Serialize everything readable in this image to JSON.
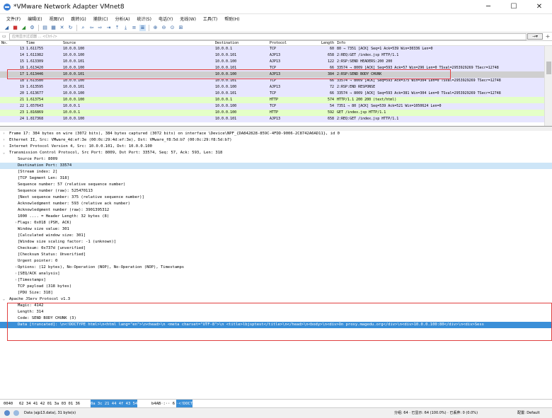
{
  "window": {
    "title": "*VMware Network Adapter VMnet8",
    "minimize": "─",
    "maximize": "☐",
    "close": "✕"
  },
  "menu": [
    "文件(F)",
    "编辑(E)",
    "视图(V)",
    "跳转(G)",
    "捕获(C)",
    "分析(A)",
    "统计(S)",
    "电话(Y)",
    "无线(W)",
    "工具(T)",
    "帮助(H)"
  ],
  "filter": {
    "placeholder": "应用显示过滤器 … <Ctrl-/>",
    "arrow": "→▾",
    "plus": "+"
  },
  "columns": {
    "no": "No.",
    "time": "Time",
    "source": "Source",
    "destination": "Destination",
    "protocol": "Protocol",
    "length": "Length",
    "info": "Info"
  },
  "packets": [
    {
      "no": "13",
      "time": "1.611755",
      "src": "10.0.0.100",
      "dst": "10.0.0.1",
      "proto": "TCP",
      "len": "60",
      "info": "80 → 7351 [ACK] Seq=1 Ack=539 Win=30336 Len=0",
      "bg": "#e7e6ff"
    },
    {
      "no": "14",
      "time": "1.611982",
      "src": "10.0.0.100",
      "dst": "10.0.0.101",
      "proto": "AJP13",
      "len": "658",
      "info": "2:REQ:GET /index.jsp HTTP/1.1",
      "bg": "#e7e6ff"
    },
    {
      "no": "15",
      "time": "1.613309",
      "src": "10.0.0.101",
      "dst": "10.0.0.100",
      "proto": "AJP13",
      "len": "122",
      "info": "2:RSP:SEND HEADERS:200 200",
      "bg": "#e7e6ff"
    },
    {
      "no": "16",
      "time": "1.613420",
      "src": "10.0.0.100",
      "dst": "10.0.0.101",
      "proto": "TCP",
      "len": "66",
      "info": "33574 → 8009 [ACK] Seq=593 Ack=57 Win=296 Len=0 TSval=2953929269 TSecr=12748",
      "bg": "#e7e6ff"
    },
    {
      "no": "17",
      "time": "1.613446",
      "src": "10.0.0.101",
      "dst": "10.0.0.100",
      "proto": "AJP13",
      "len": "384",
      "info": "2:RSP:SEND BODY CHUNK",
      "bg": "#cfcfcf"
    },
    {
      "no": "18",
      "time": "1.613580",
      "src": "10.0.0.100",
      "dst": "10.0.0.101",
      "proto": "TCP",
      "len": "66",
      "info": "33574 → 8009 [ACK] Seq=593 Ack=375 Win=304 Len=0 TSval=2953929269 TSecr=12748",
      "bg": "#e7e6ff"
    },
    {
      "no": "19",
      "time": "1.613595",
      "src": "10.0.0.101",
      "dst": "10.0.0.100",
      "proto": "AJP13",
      "len": "72",
      "info": "2:RSP:END RESPONSE",
      "bg": "#e7e6ff"
    },
    {
      "no": "20",
      "time": "1.613677",
      "src": "10.0.0.100",
      "dst": "10.0.0.101",
      "proto": "TCP",
      "len": "66",
      "info": "33574 → 8009 [ACK] Seq=593 Ack=381 Win=304 Len=0 TSval=2953929269 TSecr=12748",
      "bg": "#e7e6ff"
    },
    {
      "no": "21",
      "time": "1.613754",
      "src": "10.0.0.100",
      "dst": "10.0.0.1",
      "proto": "HTTP",
      "len": "574",
      "info": "HTTP/1.1 200 200  (text/html)",
      "bg": "#e4ffc7"
    },
    {
      "no": "22",
      "time": "1.657643",
      "src": "10.0.0.1",
      "dst": "10.0.0.100",
      "proto": "TCP",
      "len": "54",
      "info": "7351 → 80 [ACK] Seq=539 Ack=521 Win=1050624 Len=0",
      "bg": "#e7e6ff"
    },
    {
      "no": "23",
      "time": "1.816869",
      "src": "10.0.0.1",
      "dst": "10.0.0.100",
      "proto": "HTTP",
      "len": "592",
      "info": "GET /index.jsp HTTP/1.1",
      "bg": "#e4ffc7"
    },
    {
      "no": "24",
      "time": "1.817368",
      "src": "10.0.0.100",
      "dst": "10.0.0.101",
      "proto": "AJP13",
      "len": "658",
      "info": "2:REQ:GET /index.jsp HTTP/1.1",
      "bg": "#e7e6ff"
    }
  ],
  "details": [
    {
      "text": "Frame 17: 384 bytes on wire (3072 bits), 384 bytes captured (3072 bits) on interface \\Device\\NPF_{DA842828-859C-4FDD-9006-2C8742A6AD11}, id 0",
      "indent": 0,
      "tri": "›",
      "style": ""
    },
    {
      "text": "Ethernet II, Src: VMware_4d:ef:3e (00:0c:29:4d:ef:3e), Dst: VMware_f8:5d:b7 (00:0c:29:f8:5d:b7)",
      "indent": 0,
      "tri": "›",
      "style": ""
    },
    {
      "text": "Internet Protocol Version 4, Src: 10.0.0.101, Dst: 10.0.0.100",
      "indent": 0,
      "tri": "›",
      "style": ""
    },
    {
      "text": "Transmission Control Protocol, Src Port: 8009, Dst Port: 33574, Seq: 57, Ack: 593, Len: 318",
      "indent": 0,
      "tri": "⌄",
      "style": ""
    },
    {
      "text": "Source Port: 8009",
      "indent": 1,
      "tri": "",
      "style": ""
    },
    {
      "text": "Destination Port: 33574",
      "indent": 1,
      "tri": "",
      "style": "sel"
    },
    {
      "text": "[Stream index: 2]",
      "indent": 1,
      "tri": "",
      "style": ""
    },
    {
      "text": "[TCP Segment Len: 318]",
      "indent": 1,
      "tri": "",
      "style": ""
    },
    {
      "text": "Sequence number: 57    (relative sequence number)",
      "indent": 1,
      "tri": "",
      "style": ""
    },
    {
      "text": "Sequence number (raw): 525470113",
      "indent": 1,
      "tri": "",
      "style": ""
    },
    {
      "text": "[Next sequence number: 375    (relative sequence number)]",
      "indent": 1,
      "tri": "",
      "style": ""
    },
    {
      "text": "Acknowledgment number: 593    (relative ack number)",
      "indent": 1,
      "tri": "",
      "style": ""
    },
    {
      "text": "Acknowledgment number (raw): 3901395312",
      "indent": 1,
      "tri": "",
      "style": ""
    },
    {
      "text": "1000 .... = Header Length: 32 bytes (8)",
      "indent": 1,
      "tri": "",
      "style": ""
    },
    {
      "text": "Flags: 0x018 (PSH, ACK)",
      "indent": 1,
      "tri": "›",
      "style": ""
    },
    {
      "text": "Window size value: 301",
      "indent": 1,
      "tri": "",
      "style": ""
    },
    {
      "text": "[Calculated window size: 301]",
      "indent": 1,
      "tri": "",
      "style": ""
    },
    {
      "text": "[Window size scaling factor: -1 (unknown)]",
      "indent": 1,
      "tri": "",
      "style": ""
    },
    {
      "text": "Checksum: 0x737d [unverified]",
      "indent": 1,
      "tri": "",
      "style": ""
    },
    {
      "text": "[Checksum Status: Unverified]",
      "indent": 1,
      "tri": "",
      "style": ""
    },
    {
      "text": "Urgent pointer: 0",
      "indent": 1,
      "tri": "",
      "style": ""
    },
    {
      "text": "Options: (12 bytes), No-Operation (NOP), No-Operation (NOP), Timestamps",
      "indent": 1,
      "tri": "›",
      "style": ""
    },
    {
      "text": "[SEQ/ACK analysis]",
      "indent": 1,
      "tri": "›",
      "style": ""
    },
    {
      "text": "[Timestamps]",
      "indent": 1,
      "tri": "›",
      "style": ""
    },
    {
      "text": "TCP payload (318 bytes)",
      "indent": 1,
      "tri": "",
      "style": ""
    },
    {
      "text": "[PDU Size: 318]",
      "indent": 1,
      "tri": "",
      "style": ""
    },
    {
      "text": "Apache JServ Protocol v1.3",
      "indent": 0,
      "tri": "⌄",
      "style": ""
    },
    {
      "text": "Magic: 4142",
      "indent": 1,
      "tri": "",
      "style": ""
    },
    {
      "text": "Length: 314",
      "indent": 1,
      "tri": "",
      "style": ""
    },
    {
      "text": "Code: SEND BODY CHUNK (3)",
      "indent": 1,
      "tri": "",
      "style": ""
    },
    {
      "text": "Data [truncated]: \\n<!DOCTYPE html>\\n<html lang=\"en\">\\n<head>\\n    <meta charset=\"UTF-8\">\\n    <title>lbjsptest</title>\\n</head>\\n<body>\\n<div>On  proxy.magedu.org</div>\\n<div>10.0.0.100:80</div>\\n<div>Sess",
      "indent": 1,
      "tri": "",
      "style": "sel2"
    }
  ],
  "hex": {
    "offset": "0040",
    "bytes": "62 34 41 42 01 3a 03 01  36",
    "sel_bytes": "0a 3c 21 44 4f 43 54",
    "ascii": "b4AB·:·· 6",
    "sel_ascii": "·<!DOCT"
  },
  "status": {
    "info": "Data (ajp13.data), 31 byte(s)",
    "packets": "分组: 64 · 已显示: 64 (100.0%) · 已丢弃: 0 (0.0%)",
    "profile": "配置: Default"
  },
  "colors": {
    "tcp": "#e7e6ff",
    "http": "#e4ffc7",
    "highlight": "#e04040",
    "selection": "#3a8fd8"
  }
}
